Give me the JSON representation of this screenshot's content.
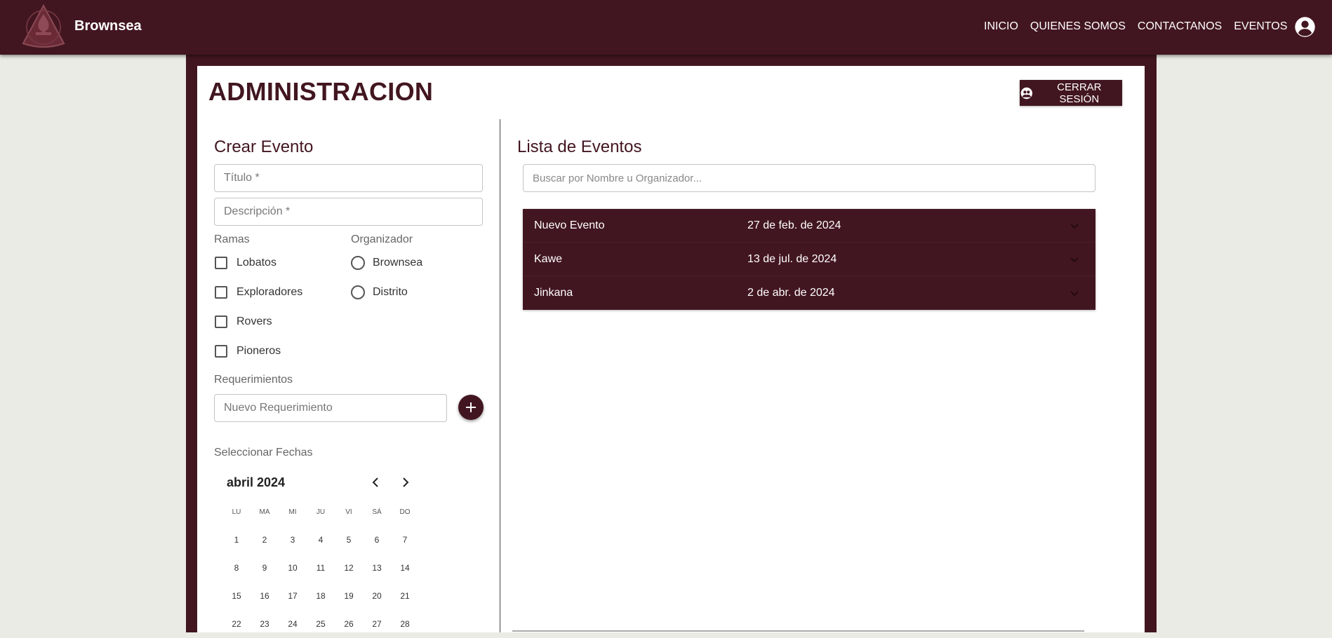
{
  "navbar": {
    "brand": "Brownsea",
    "links": [
      "INICIO",
      "QUIENES SOMOS",
      "CONTACTANOS",
      "EVENTOS"
    ]
  },
  "page": {
    "title": "ADMINISTRACION",
    "logout_label": "CERRAR SESIÓN"
  },
  "create_event": {
    "title": "Crear Evento",
    "titulo_placeholder": "Título *",
    "descripcion_placeholder": "Descripción *",
    "ramas_label": "Ramas",
    "ramas": [
      "Lobatos",
      "Exploradores",
      "Rovers",
      "Pioneros"
    ],
    "organizador_label": "Organizador",
    "organizadores": [
      "Brownsea",
      "Distrito"
    ],
    "requerimientos_label": "Requerimientos",
    "requerimiento_placeholder": "Nuevo Requerimiento",
    "fechas_label": "Seleccionar Fechas"
  },
  "calendar": {
    "month": "abril 2024",
    "weekdays": [
      "LU",
      "MA",
      "MI",
      "JU",
      "VI",
      "SÁ",
      "DO"
    ],
    "weeks": [
      [
        "1",
        "2",
        "3",
        "4",
        "5",
        "6",
        "7"
      ],
      [
        "8",
        "9",
        "10",
        "11",
        "12",
        "13",
        "14"
      ],
      [
        "15",
        "16",
        "17",
        "18",
        "19",
        "20",
        "21"
      ],
      [
        "22",
        "23",
        "24",
        "25",
        "26",
        "27",
        "28"
      ]
    ]
  },
  "event_list": {
    "title": "Lista de Eventos",
    "search_placeholder": "Buscar por Nombre u Organizador...",
    "events": [
      {
        "name": "Nuevo Evento",
        "date": "27 de feb. de 2024"
      },
      {
        "name": "Kawe",
        "date": "13 de jul. de 2024"
      },
      {
        "name": "Jinkana",
        "date": "2 de abr. de 2024"
      }
    ]
  },
  "colors": {
    "primary": "#421620",
    "background": "#ebebe6"
  },
  "icons": {
    "account": "account-circle-icon",
    "logout": "logout-icon",
    "add": "plus-icon",
    "expand": "chevron-down-icon"
  }
}
